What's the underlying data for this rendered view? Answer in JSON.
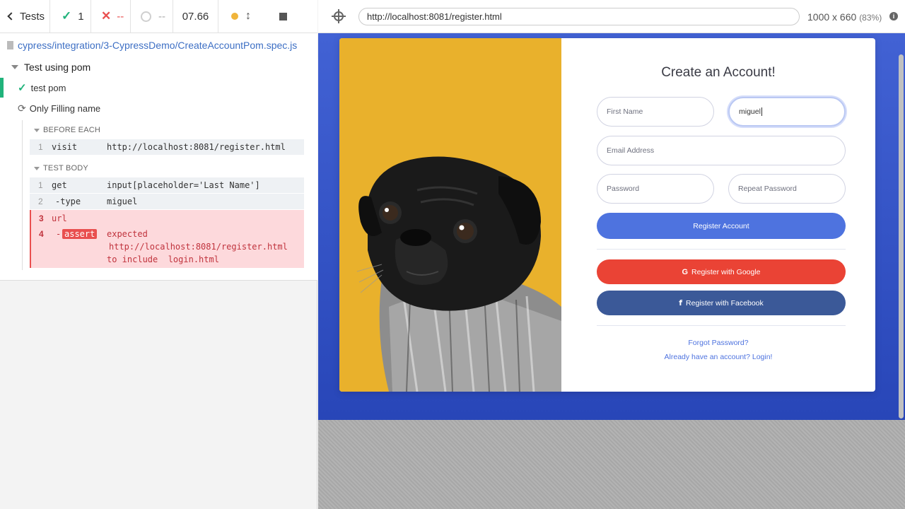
{
  "reporter": {
    "header": {
      "tests_label": "Tests",
      "passed": "1",
      "failed": "--",
      "pending": "--",
      "duration": "07.66"
    },
    "spec_path": "cypress/integration/3-CypressDemo/CreateAccountPom.spec.js",
    "suite_title": "Test using pom",
    "tests": [
      {
        "title": "test pom",
        "state": "passed"
      },
      {
        "title": "Only Filling name",
        "state": "failed"
      }
    ],
    "before_each": {
      "title": "BEFORE EACH",
      "commands": [
        {
          "num": "1",
          "name": "visit",
          "message": "http://localhost:8081/register.html"
        }
      ]
    },
    "test_body": {
      "title": "TEST BODY",
      "commands": [
        {
          "num": "1",
          "name": "get",
          "message": "input[placeholder='Last Name']"
        },
        {
          "num": "2",
          "name": "-type",
          "message": "miguel"
        },
        {
          "num": "3",
          "name": "url",
          "message": ""
        },
        {
          "num": "4",
          "name": "-",
          "badge": "assert",
          "message_lines": [
            "expected",
            "http://localhost:8081/register.html",
            "to include  login.html"
          ]
        }
      ]
    }
  },
  "aut": {
    "url": "http://localhost:8081/register.html",
    "viewport": "1000 x 660",
    "scale": "(83%)",
    "info_icon": "i",
    "page": {
      "title": "Create an Account!",
      "first_name_placeholder": "First Name",
      "last_name_value": "miguel",
      "email_placeholder": "Email Address",
      "password_placeholder": "Password",
      "repeat_password_placeholder": "Repeat Password",
      "register_button": "Register Account",
      "google_button": "Register with Google",
      "facebook_button": "Register with Facebook",
      "google_icon": "G",
      "facebook_icon": "f",
      "forgot_link": "Forgot Password?",
      "login_link": "Already have an account? Login!"
    }
  },
  "colors": {
    "pass": "#20b37b",
    "fail": "#e94f4f",
    "primary": "#4e73df",
    "google": "#ea4335",
    "facebook": "#3b5998",
    "dog_background": "#e9b12c"
  }
}
